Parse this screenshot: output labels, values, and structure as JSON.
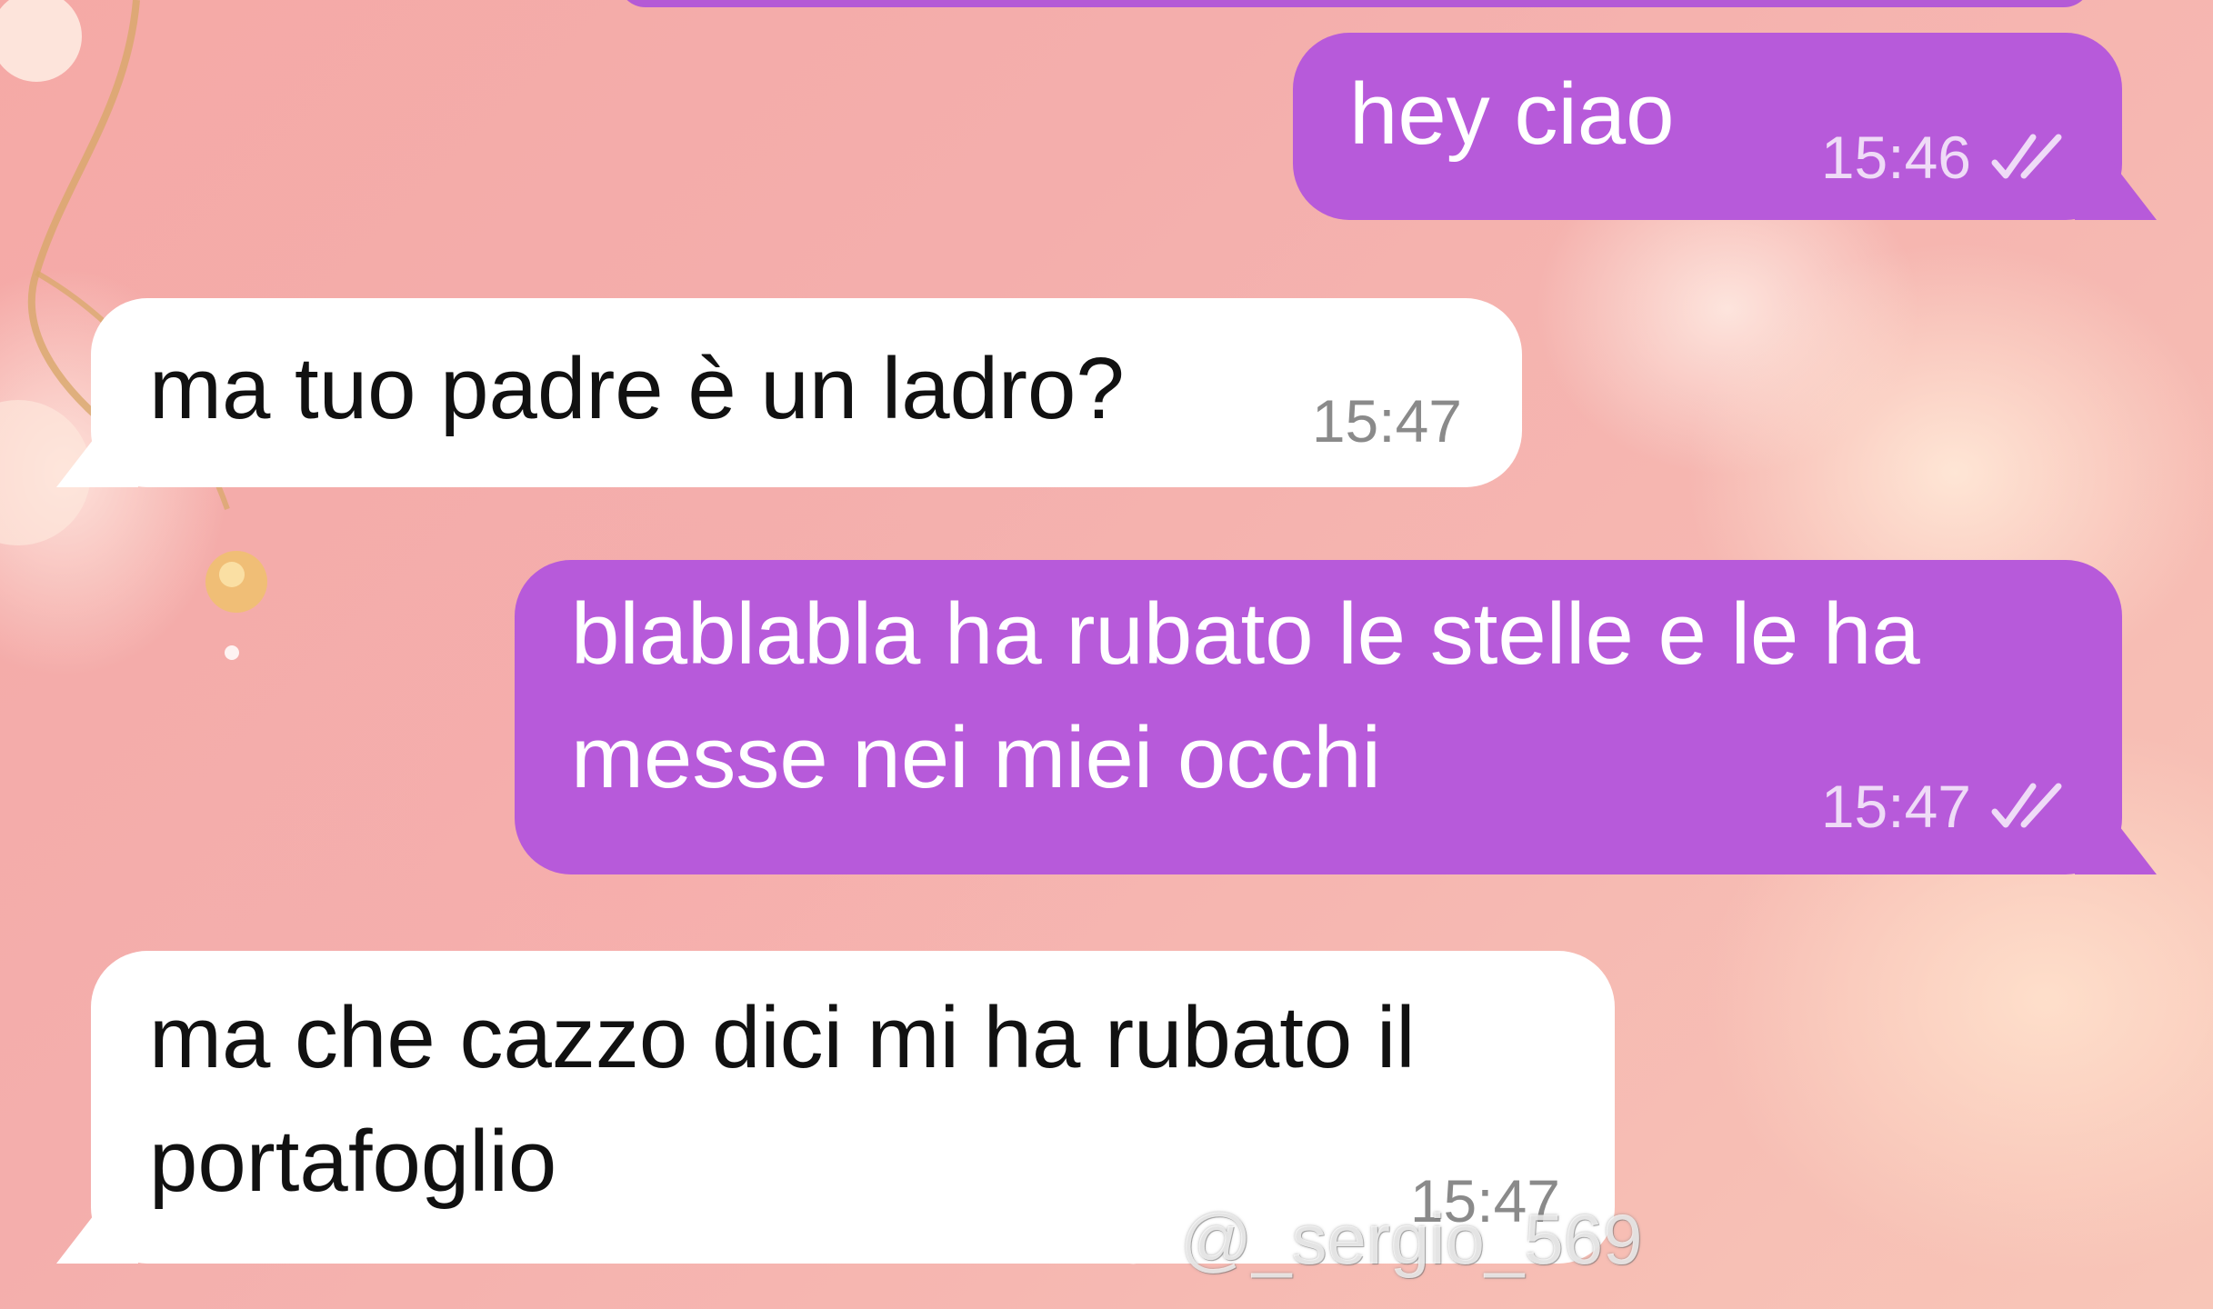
{
  "colors": {
    "outgoing_bubble": "#b75ada",
    "incoming_bubble": "#ffffff",
    "background": "#f5a9a6"
  },
  "messages": [
    {
      "direction": "out",
      "text": "hey ciao",
      "time": "15:46",
      "status_icon": "double-check-icon"
    },
    {
      "direction": "in",
      "text": "ma tuo padre è un ladro?",
      "time": "15:47"
    },
    {
      "direction": "out",
      "text": "blablabla ha rubato le stelle e le ha\nmesse nei miei occhi",
      "time": "15:47",
      "status_icon": "double-check-icon"
    },
    {
      "direction": "in",
      "text": "ma che cazzo dici mi ha rubato il\nportafoglio",
      "time": "15:47"
    }
  ],
  "watermark": {
    "icon": "tiktok-icon",
    "handle": "@_sergio_569"
  }
}
